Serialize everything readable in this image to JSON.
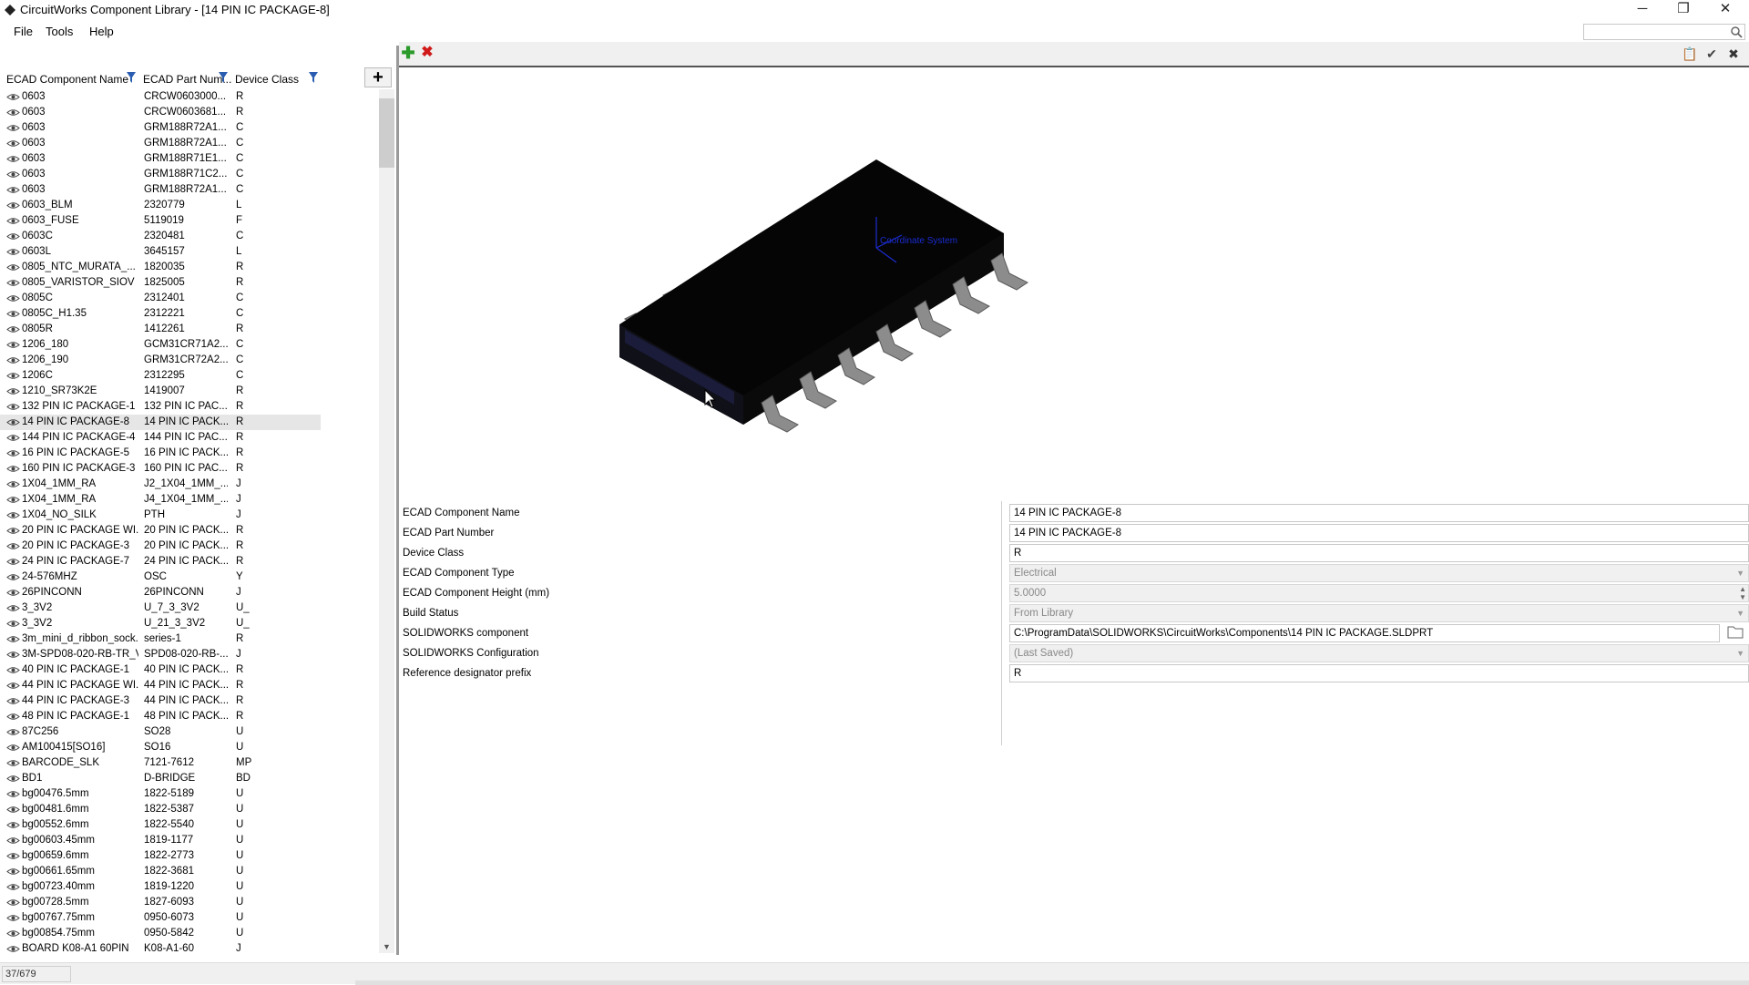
{
  "window": {
    "title": "CircuitWorks Component Library - [14 PIN IC PACKAGE-8]",
    "minimize_glyph": "─",
    "maximize_glyph": "❐",
    "close_glyph": "✕"
  },
  "menu": {
    "file": "File",
    "tools": "Tools",
    "help": "Help"
  },
  "search": {
    "placeholder": "",
    "icon": "search-icon"
  },
  "list": {
    "headers": {
      "name": "ECAD Component Name",
      "part": "ECAD Part Num...",
      "class": "Device Class"
    },
    "add_glyph": "+",
    "selected_index": 21,
    "rows": [
      {
        "name": "0603",
        "part": "CRCW0603000...",
        "cls": "R"
      },
      {
        "name": "0603",
        "part": "CRCW0603681...",
        "cls": "R"
      },
      {
        "name": "0603",
        "part": "GRM188R72A1...",
        "cls": "C"
      },
      {
        "name": "0603",
        "part": "GRM188R72A1...",
        "cls": "C"
      },
      {
        "name": "0603",
        "part": "GRM188R71E1...",
        "cls": "C"
      },
      {
        "name": "0603",
        "part": "GRM188R71C2...",
        "cls": "C"
      },
      {
        "name": "0603",
        "part": "GRM188R72A1...",
        "cls": "C"
      },
      {
        "name": "0603_BLM",
        "part": "2320779",
        "cls": "L"
      },
      {
        "name": "0603_FUSE",
        "part": "5119019",
        "cls": "F"
      },
      {
        "name": "0603C",
        "part": "2320481",
        "cls": "C"
      },
      {
        "name": "0603L",
        "part": "3645157",
        "cls": "L"
      },
      {
        "name": "0805_NTC_MURATA_...",
        "part": "1820035",
        "cls": "R"
      },
      {
        "name": "0805_VARISTOR_SIOV",
        "part": "1825005",
        "cls": "R"
      },
      {
        "name": "0805C",
        "part": "2312401",
        "cls": "C"
      },
      {
        "name": "0805C_H1.35",
        "part": "2312221",
        "cls": "C"
      },
      {
        "name": "0805R",
        "part": "1412261",
        "cls": "R"
      },
      {
        "name": "1206_180",
        "part": "GCM31CR71A2...",
        "cls": "C"
      },
      {
        "name": "1206_190",
        "part": "GRM31CR72A2...",
        "cls": "C"
      },
      {
        "name": "1206C",
        "part": "2312295",
        "cls": "C"
      },
      {
        "name": "1210_SR73K2E",
        "part": "1419007",
        "cls": "R"
      },
      {
        "name": "132 PIN IC PACKAGE-1",
        "part": "132 PIN IC PAC...",
        "cls": "R"
      },
      {
        "name": "14 PIN IC PACKAGE-8",
        "part": "14 PIN IC PACK...",
        "cls": "R"
      },
      {
        "name": "144 PIN IC PACKAGE-4",
        "part": "144 PIN IC PAC...",
        "cls": "R"
      },
      {
        "name": "16 PIN IC PACKAGE-5",
        "part": "16 PIN IC PACK...",
        "cls": "R"
      },
      {
        "name": "160 PIN IC PACKAGE-3",
        "part": "160 PIN IC PAC...",
        "cls": "R"
      },
      {
        "name": "1X04_1MM_RA",
        "part": "J2_1X04_1MM_...",
        "cls": "J"
      },
      {
        "name": "1X04_1MM_RA",
        "part": "J4_1X04_1MM_...",
        "cls": "J"
      },
      {
        "name": "1X04_NO_SILK",
        "part": "PTH",
        "cls": "J"
      },
      {
        "name": "20 PIN IC PACKAGE WI...",
        "part": "20 PIN IC PACK...",
        "cls": "R"
      },
      {
        "name": "20 PIN IC PACKAGE-3",
        "part": "20 PIN IC PACK...",
        "cls": "R"
      },
      {
        "name": "24 PIN IC PACKAGE-7",
        "part": "24 PIN IC PACK...",
        "cls": "R"
      },
      {
        "name": "24-576MHZ",
        "part": "OSC",
        "cls": "Y"
      },
      {
        "name": "26PINCONN",
        "part": "26PINCONN",
        "cls": "J"
      },
      {
        "name": "3_3V2",
        "part": "U_7_3_3V2",
        "cls": "U_"
      },
      {
        "name": "3_3V2",
        "part": "U_21_3_3V2",
        "cls": "U_"
      },
      {
        "name": "3m_mini_d_ribbon_sock...",
        "part": "series-1",
        "cls": "R"
      },
      {
        "name": "3M-SPD08-020-RB-TR_V",
        "part": "SPD08-020-RB-...",
        "cls": "J"
      },
      {
        "name": "40 PIN IC PACKAGE-1",
        "part": "40 PIN IC PACK...",
        "cls": "R"
      },
      {
        "name": "44 PIN IC PACKAGE WI...",
        "part": "44 PIN IC PACK...",
        "cls": "R"
      },
      {
        "name": "44 PIN IC PACKAGE-3",
        "part": "44 PIN IC PACK...",
        "cls": "R"
      },
      {
        "name": "48 PIN IC PACKAGE-1",
        "part": "48 PIN IC PACK...",
        "cls": "R"
      },
      {
        "name": "87C256",
        "part": "SO28",
        "cls": "U"
      },
      {
        "name": "AM100415[SO16]",
        "part": "SO16",
        "cls": "U"
      },
      {
        "name": "BARCODE_SLK",
        "part": "7121-7612",
        "cls": "MP"
      },
      {
        "name": "BD1",
        "part": "D-BRIDGE",
        "cls": "BD"
      },
      {
        "name": "bg00476.5mm",
        "part": "1822-5189",
        "cls": "U"
      },
      {
        "name": "bg00481.6mm",
        "part": "1822-5387",
        "cls": "U"
      },
      {
        "name": "bg00552.6mm",
        "part": "1822-5540",
        "cls": "U"
      },
      {
        "name": "bg00603.45mm",
        "part": "1819-1177",
        "cls": "U"
      },
      {
        "name": "bg00659.6mm",
        "part": "1822-2773",
        "cls": "U"
      },
      {
        "name": "bg00661.65mm",
        "part": "1822-3681",
        "cls": "U"
      },
      {
        "name": "bg00723.40mm",
        "part": "1819-1220",
        "cls": "U"
      },
      {
        "name": "bg00728.5mm",
        "part": "1827-6093",
        "cls": "U"
      },
      {
        "name": "bg00767.75mm",
        "part": "0950-6073",
        "cls": "U"
      },
      {
        "name": "bg00854.75mm",
        "part": "0950-5842",
        "cls": "U"
      },
      {
        "name": "BOARD K08-A1 60PIN",
        "part": "K08-A1-60",
        "cls": "J"
      }
    ]
  },
  "toolbar": {
    "add_glyph": "✚",
    "delete_glyph": "✖",
    "clipboard_glyph": "📋",
    "apply_glyph": "✔",
    "close_glyph": "✖"
  },
  "preview": {
    "overlay_text": "Coordinate System"
  },
  "properties": [
    {
      "label": "ECAD Component Name",
      "value": "14 PIN IC PACKAGE-8",
      "kind": "text"
    },
    {
      "label": "ECAD Part Number",
      "value": "14 PIN IC PACKAGE-8",
      "kind": "text"
    },
    {
      "label": "Device Class",
      "value": "R",
      "kind": "text"
    },
    {
      "label": "ECAD Component Type",
      "value": "Electrical",
      "kind": "dropdown-disabled"
    },
    {
      "label": "ECAD Component Height (mm)",
      "value": "5.0000",
      "kind": "spin-disabled"
    },
    {
      "label": "Build Status",
      "value": "From Library",
      "kind": "dropdown-disabled"
    },
    {
      "label": "SOLIDWORKS component",
      "value": "C:\\ProgramData\\SOLIDWORKS\\CircuitWorks\\Components\\14 PIN IC PACKAGE.SLDPRT",
      "kind": "path"
    },
    {
      "label": "SOLIDWORKS Configuration",
      "value": "(Last Saved)",
      "kind": "dropdown-disabled"
    },
    {
      "label": "Reference designator prefix",
      "value": "R",
      "kind": "text"
    }
  ],
  "status": {
    "count": "37/679"
  },
  "colors": {
    "selected_row": "#e6e6e6",
    "ic_body": "#050505",
    "pin": "#8c8c8c",
    "overlay": "#1a2bd0"
  }
}
